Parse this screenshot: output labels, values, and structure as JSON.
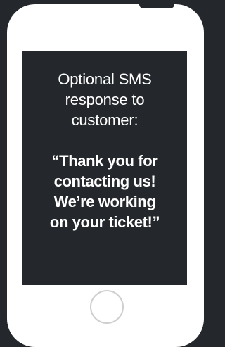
{
  "screen": {
    "intro_lines": [
      "Optional SMS",
      "response to",
      "customer:"
    ],
    "quote_lines": [
      "“Thank you for",
      "contacting us!",
      "We’re working",
      "on your ticket!”"
    ]
  },
  "colors": {
    "background": "#24282c",
    "phone_body": "#ffffff",
    "screen": "#24282c",
    "text": "#ffffff",
    "home_button_ring": "#cfcfcf"
  },
  "icons": {
    "home_button": "circle-outline"
  }
}
